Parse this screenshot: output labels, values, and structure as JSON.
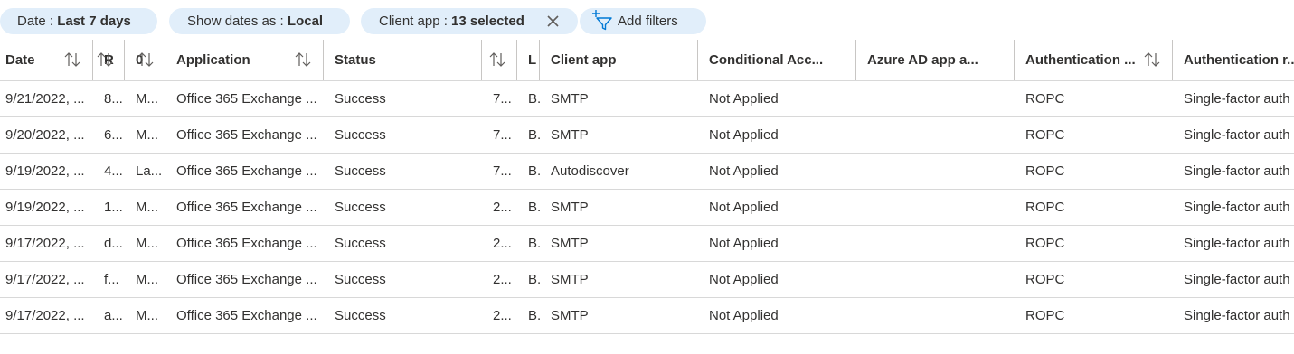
{
  "filters": [
    {
      "label": "Date : ",
      "value": "Last 7 days"
    },
    {
      "label": "Show dates as : ",
      "value": "Local"
    },
    {
      "label": "Client app : ",
      "value": "13 selected"
    }
  ],
  "add_filters_label": "Add filters",
  "columns": [
    "Date",
    "R",
    "0",
    "Application",
    "Status",
    "",
    "L",
    "Client app",
    "Conditional Acc...",
    "Azure AD app a...",
    "Authentication ...",
    "Authentication r..."
  ],
  "rows": [
    [
      "9/21/2022, ...",
      "8...",
      "M...",
      "Office 365 Exchange ...",
      "Success",
      "7...",
      "B.",
      "SMTP",
      "Not Applied",
      "",
      "ROPC",
      "Single-factor auth"
    ],
    [
      "9/20/2022, ...",
      "6...",
      "M...",
      "Office 365 Exchange ...",
      "Success",
      "7...",
      "B.",
      "SMTP",
      "Not Applied",
      "",
      "ROPC",
      "Single-factor auth"
    ],
    [
      "9/19/2022, ...",
      "4...",
      "La...",
      "Office 365 Exchange ...",
      "Success",
      "7...",
      "B.",
      "Autodiscover",
      "Not Applied",
      "",
      "ROPC",
      "Single-factor auth"
    ],
    [
      "9/19/2022, ...",
      "1...",
      "M...",
      "Office 365 Exchange ...",
      "Success",
      "2...",
      "B.",
      "SMTP",
      "Not Applied",
      "",
      "ROPC",
      "Single-factor auth"
    ],
    [
      "9/17/2022, ...",
      "d...",
      "M...",
      "Office 365 Exchange ...",
      "Success",
      "2...",
      "B.",
      "SMTP",
      "Not Applied",
      "",
      "ROPC",
      "Single-factor auth"
    ],
    [
      "9/17/2022, ...",
      "f...",
      "M...",
      "Office 365 Exchange ...",
      "Success",
      "2...",
      "B.",
      "SMTP",
      "Not Applied",
      "",
      "ROPC",
      "Single-factor auth"
    ],
    [
      "9/17/2022, ...",
      "a...",
      "M...",
      "Office 365 Exchange ...",
      "Success",
      "2...",
      "B.",
      "SMTP",
      "Not Applied",
      "",
      "ROPC",
      "Single-factor auth"
    ]
  ],
  "colors": {
    "pill_bg": "#e1eefa",
    "accent": "#0078d4",
    "divider": "#c8c6c4",
    "row_border": "#d8d8d8"
  }
}
